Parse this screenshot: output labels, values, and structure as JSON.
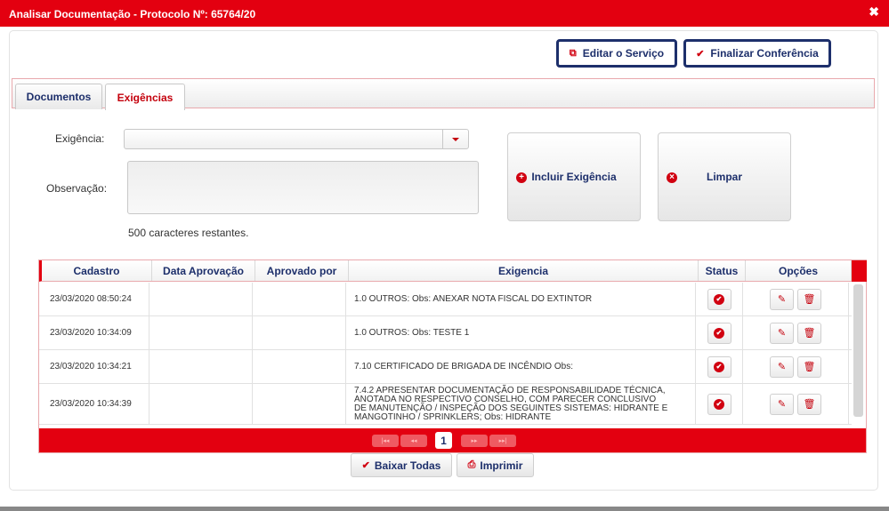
{
  "window": {
    "title": "Analisar Documentação - Protocolo Nº: 65764/20",
    "close": "✖"
  },
  "toolbar": {
    "edit_label": "Editar o Serviço",
    "finish_label": "Finalizar Conferência"
  },
  "tabs": [
    {
      "label": "Documentos"
    },
    {
      "label": "Exigências"
    }
  ],
  "form": {
    "exigencia_label": "Exigência:",
    "exigencia_value": "",
    "observacao_label": "Observação:",
    "observacao_value": "",
    "remaining": "500 caracteres restantes.",
    "include_label": "Incluir Exigência",
    "clear_label": "Limpar"
  },
  "table": {
    "headers": [
      "Cadastro",
      "Data Aprovação",
      "Aprovado por",
      "Exigencia",
      "Status",
      "Opções"
    ],
    "rows": [
      {
        "cadastro": "23/03/2020 08:50:24",
        "data_aprovacao": "",
        "aprovado_por": "",
        "exigencia": "1.0 OUTROS: Obs: ANEXAR NOTA FISCAL DO EXTINTOR"
      },
      {
        "cadastro": "23/03/2020 10:34:09",
        "data_aprovacao": "",
        "aprovado_por": "",
        "exigencia": "1.0 OUTROS: Obs: TESTE 1"
      },
      {
        "cadastro": "23/03/2020 10:34:21",
        "data_aprovacao": "",
        "aprovado_por": "",
        "exigencia": "7.10 CERTIFICADO DE BRIGADA DE INCÊNDIO Obs:"
      },
      {
        "cadastro": "23/03/2020 10:34:39",
        "data_aprovacao": "",
        "aprovado_por": "",
        "exigencia": "7.4.2 APRESENTAR DOCUMENTAÇÃO DE RESPONSABILIDADE TÉCNICA, ANOTADA NO RESPECTIVO CONSELHO, COM PARECER CONCLUSIVO DE MANUTENÇÃO / INSPEÇÃO DOS SEGUINTES SISTEMAS: HIDRANTE E MANGOTINHO / SPRINKLERS; Obs: HIDRANTE"
      }
    ]
  },
  "pager": {
    "first": "|◂◂",
    "prev": "◂◂",
    "current": "1",
    "next": "▸▸",
    "last": "▸▸|"
  },
  "footer": {
    "download_label": "Baixar Todas",
    "print_label": "Imprimir"
  },
  "colors": {
    "brand_red": "#e30010",
    "navy": "#1d2f6b"
  }
}
